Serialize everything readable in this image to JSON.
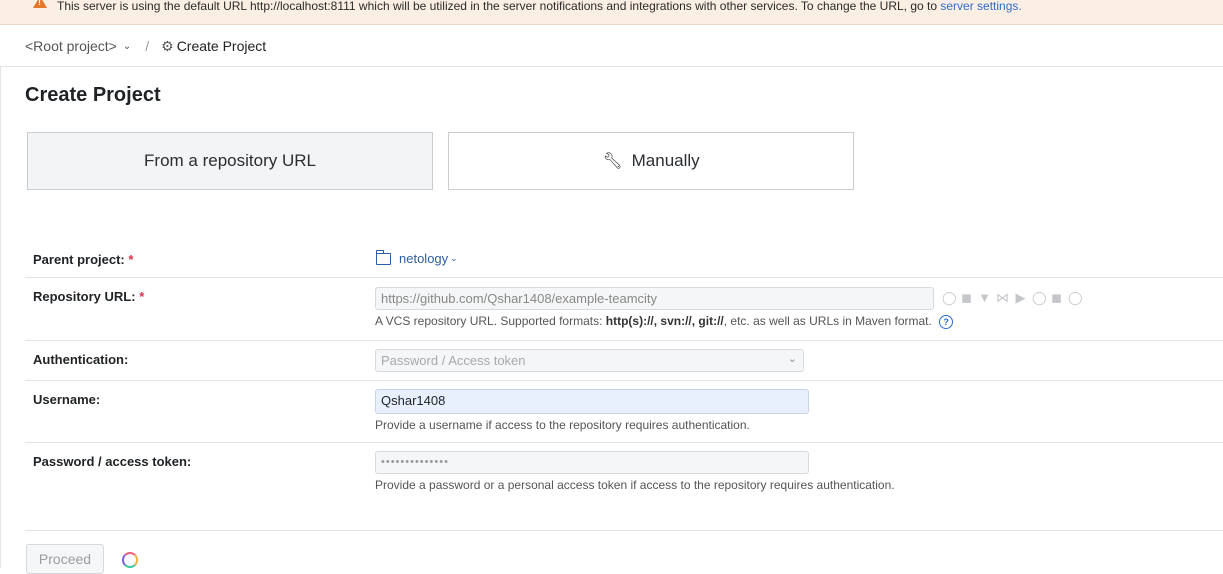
{
  "banner": {
    "text": "This server is using the default URL http://localhost:8111 which will be utilized in the server notifications and integrations with other services. To change the URL, go to ",
    "link": "server settings."
  },
  "breadcrumb": {
    "root": "<Root project>",
    "current": "Create Project"
  },
  "page_title": "Create Project",
  "tabs": {
    "repo": "From a repository URL",
    "manual": "Manually"
  },
  "form": {
    "parent_label": "Parent project:",
    "parent_value": "netology",
    "repo_label": "Repository URL:",
    "repo_value": "https://github.com/Qshar1408/example-teamcity",
    "repo_help_pre": "A VCS repository URL. Supported formats: ",
    "repo_help_formats": "http(s)://, svn://, git://",
    "repo_help_post": ", etc. as well as URLs in Maven format.",
    "auth_label": "Authentication:",
    "auth_value": "Password / Access token",
    "username_label": "Username:",
    "username_value": "Qshar1408",
    "username_help": "Provide a username if access to the repository requires authentication.",
    "password_label": "Password / access token:",
    "password_value": "••••••••••••••",
    "password_help": "Provide a password or a personal access token if access to the repository requires authentication.",
    "required_mark": "*"
  },
  "proceed": "Proceed",
  "colors": {
    "accent": "#2c6ecb",
    "required": "#d8334a",
    "banner_bg": "#fbeee3"
  }
}
